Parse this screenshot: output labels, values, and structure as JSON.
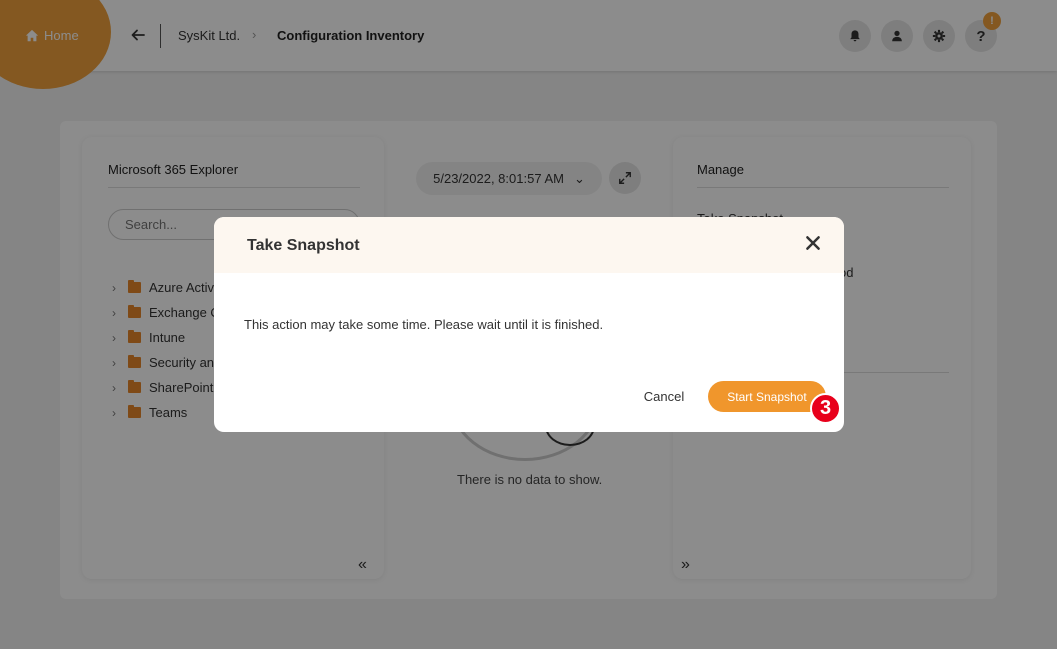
{
  "header": {
    "home_label": "Home",
    "breadcrumb_org": "SysKit Ltd.",
    "breadcrumb_separator": "›",
    "breadcrumb_page": "Configuration Inventory",
    "help_label": "?",
    "help_badge": "!",
    "icons": [
      "bell-icon",
      "user-icon",
      "gear-icon",
      "help-icon"
    ],
    "accent_color": "#f0a13c"
  },
  "left_panel": {
    "title": "Microsoft 365 Explorer",
    "search_placeholder": "Search...",
    "tree_items": [
      "Azure Activ",
      "Exchange O",
      "Intune",
      "Security an",
      "SharePoint",
      "Teams"
    ],
    "collapse_label": "«"
  },
  "center_panel": {
    "snapshot_date": "5/23/2022, 8:01:57 AM",
    "date_chevron": "⌄",
    "no_data_text": "There is no data to show."
  },
  "right_panel": {
    "title": "Manage",
    "items": [
      "Take Snapshot",
      "od"
    ],
    "expand_label": "»"
  },
  "modal": {
    "title": "Take Snapshot",
    "close_label": "✕",
    "message": "This action may take some time. Please wait until it is finished.",
    "cancel_label": "Cancel",
    "start_label": "Start Snapshot",
    "step_badge": "3",
    "button_color": "#f0962c"
  }
}
